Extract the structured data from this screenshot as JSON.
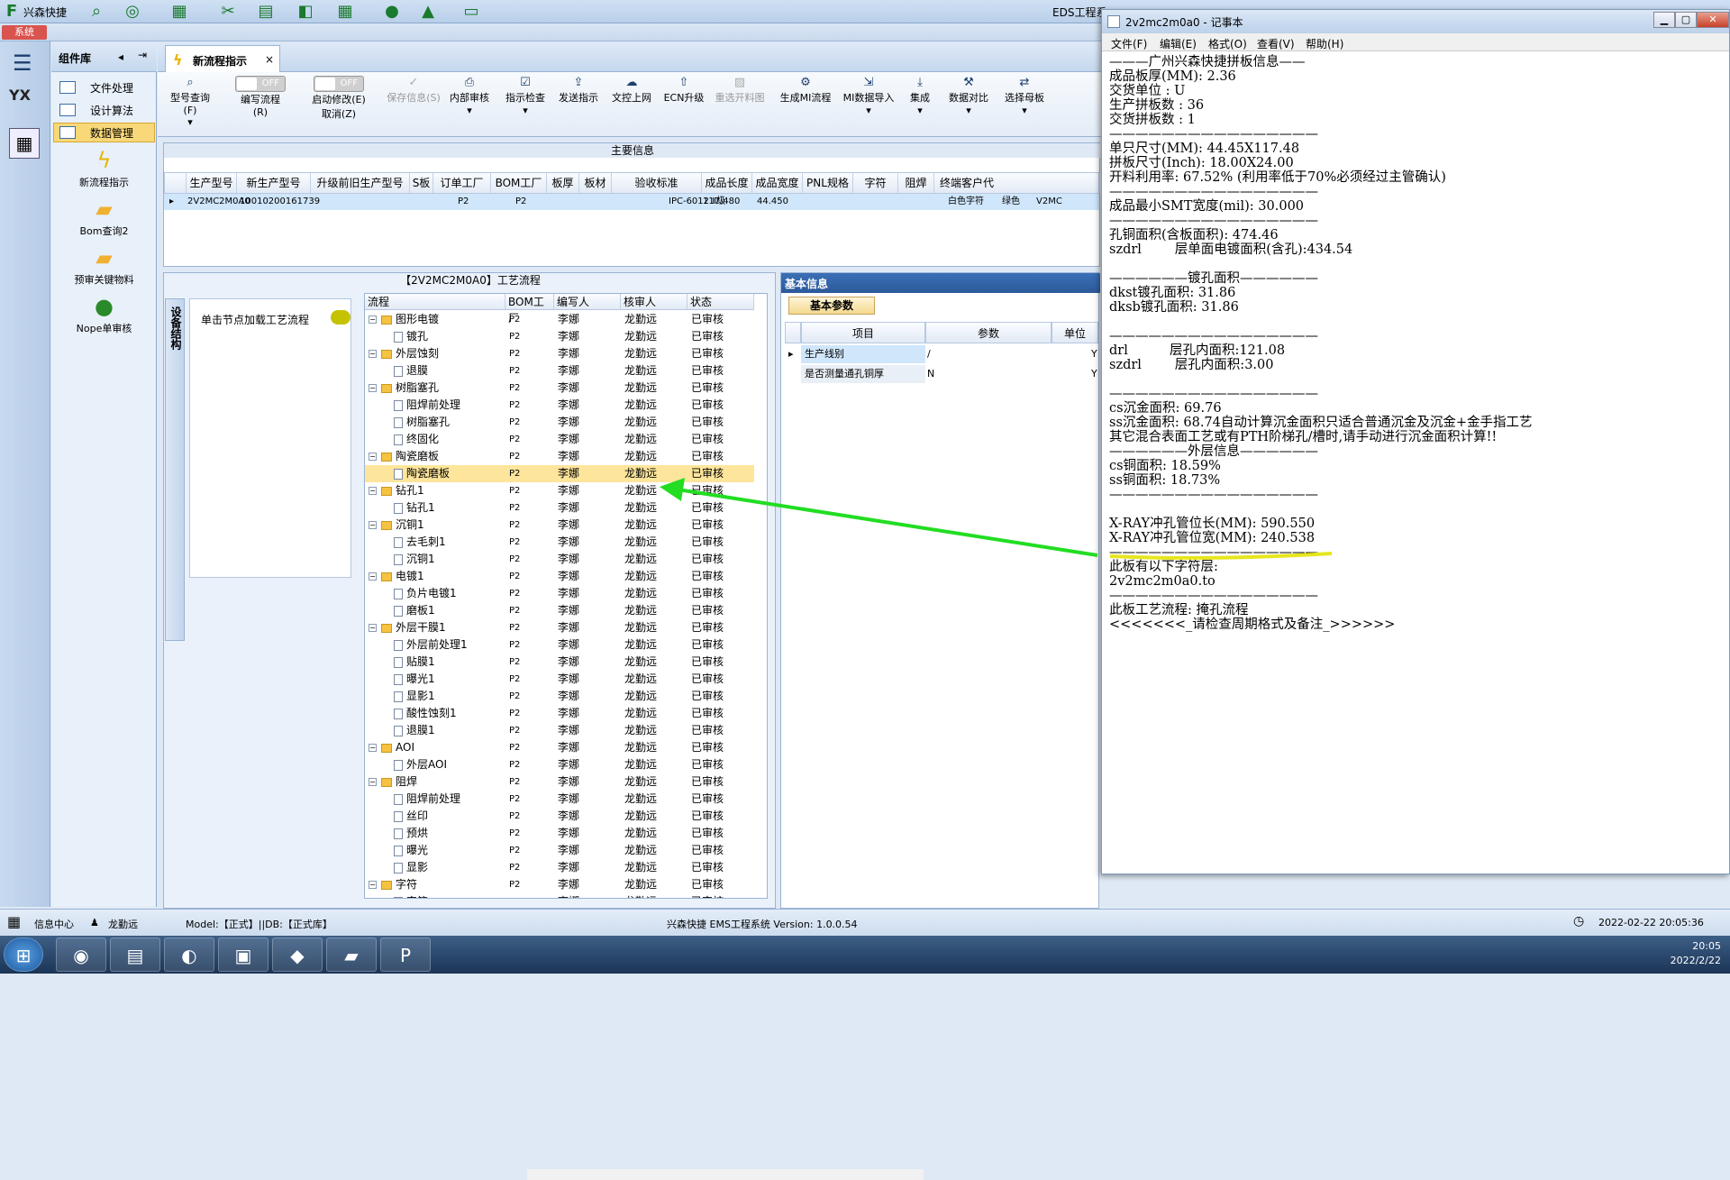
{
  "app": {
    "title": "兴森快捷",
    "eds_title": "EDS工程系",
    "system_tab": "系统"
  },
  "leftbar": {
    "logo": "YX"
  },
  "complib": {
    "header": "组件库",
    "nav": [
      {
        "label": "文件处理"
      },
      {
        "label": "设计算法"
      },
      {
        "label": "数据管理"
      }
    ],
    "launchers": [
      {
        "label": "新流程指示",
        "icon": "lightning-icon"
      },
      {
        "label": "Bom查询2",
        "icon": "folder-icon"
      },
      {
        "label": "预审关键物料",
        "icon": "folder-icon"
      },
      {
        "label": "Nope单审核",
        "icon": "user-icon"
      }
    ]
  },
  "doctab": {
    "label": "新流程指示",
    "close": "×"
  },
  "ribbon": {
    "items": [
      {
        "label": "型号查询(F)",
        "sub": "▾",
        "icon": "search-icon"
      },
      {
        "label": "编写流程(R)",
        "toggle": "OFF"
      },
      {
        "label": "启动修改(E)",
        "label2": "取消(Z)",
        "toggle": "OFF"
      },
      {
        "label": "保存信息(S)",
        "icon": "check-icon"
      },
      {
        "label": "内部审核",
        "sub": "▾",
        "icon": "print-icon"
      },
      {
        "label": "指示检查",
        "sub": "▾",
        "icon": "check-icon"
      },
      {
        "label": "发送指示",
        "icon": "send-icon"
      },
      {
        "label": "文控上网",
        "icon": "cloud-icon"
      },
      {
        "label": "ECN升级",
        "icon": "upgrade-icon"
      },
      {
        "label": "重选开料图",
        "icon": "image-icon"
      },
      {
        "label": "生成MI流程",
        "icon": "gear-icon"
      },
      {
        "label": "MI数据导入",
        "sub": "▾",
        "icon": "import-icon"
      },
      {
        "label": "集成",
        "sub": "▾",
        "icon": "download-icon"
      },
      {
        "label": "数据对比",
        "sub": "▾",
        "icon": "tool-icon"
      },
      {
        "label": "选择母板",
        "sub": "▾",
        "icon": "shuffle-icon"
      }
    ]
  },
  "maininfo": {
    "caption": "主要信息",
    "columns": [
      "生产型号",
      "新生产型号",
      "升级前旧生产型号",
      "S板",
      "订单工厂",
      "BOM工厂",
      "板厚",
      "板材",
      "验收标准",
      "成品长度",
      "成品宽度",
      "PNL规格",
      "字符",
      "阻焊",
      "终端客户代"
    ],
    "row": [
      "2V2MC2M0A0",
      "10010200161739",
      "",
      "",
      "P2",
      "P2",
      "",
      "",
      "IPC-6012 Ⅱ级",
      "117.480",
      "44.450",
      "",
      "白色字符",
      "绿色",
      "V2MC"
    ]
  },
  "process": {
    "caption": "【2V2MC2M0A0】工艺流程",
    "vtab": "设备结构",
    "hint": "单击节点加载工艺流程",
    "columns": [
      "流程",
      "BOM工厂",
      "编写人",
      "核审人",
      "状态"
    ],
    "rows": [
      {
        "name": "图形电镀",
        "lvl": 0
      },
      {
        "name": "镀孔",
        "lvl": 1
      },
      {
        "name": "外层蚀刻",
        "lvl": 0
      },
      {
        "name": "退膜",
        "lvl": 1
      },
      {
        "name": "树脂塞孔",
        "lvl": 0
      },
      {
        "name": "阻焊前处理",
        "lvl": 1
      },
      {
        "name": "树脂塞孔",
        "lvl": 1
      },
      {
        "name": "终固化",
        "lvl": 1
      },
      {
        "name": "陶瓷磨板",
        "lvl": 0
      },
      {
        "name": "陶瓷磨板",
        "lvl": 1,
        "sel": true
      },
      {
        "name": "钻孔1",
        "lvl": 0
      },
      {
        "name": "钻孔1",
        "lvl": 1
      },
      {
        "name": "沉铜1",
        "lvl": 0
      },
      {
        "name": "去毛刺1",
        "lvl": 1
      },
      {
        "name": "沉铜1",
        "lvl": 1
      },
      {
        "name": "电镀1",
        "lvl": 0
      },
      {
        "name": "负片电镀1",
        "lvl": 1
      },
      {
        "name": "磨板1",
        "lvl": 1
      },
      {
        "name": "外层干膜1",
        "lvl": 0
      },
      {
        "name": "外层前处理1",
        "lvl": 1
      },
      {
        "name": "贴膜1",
        "lvl": 1
      },
      {
        "name": "曝光1",
        "lvl": 1
      },
      {
        "name": "显影1",
        "lvl": 1
      },
      {
        "name": "酸性蚀刻1",
        "lvl": 1
      },
      {
        "name": "退膜1",
        "lvl": 1
      },
      {
        "name": "AOI",
        "lvl": 0
      },
      {
        "name": "外层AOI",
        "lvl": 1
      },
      {
        "name": "阻焊",
        "lvl": 0
      },
      {
        "name": "阻焊前处理",
        "lvl": 1
      },
      {
        "name": "丝印",
        "lvl": 1
      },
      {
        "name": "预烘",
        "lvl": 1
      },
      {
        "name": "曝光",
        "lvl": 1
      },
      {
        "name": "显影",
        "lvl": 1
      },
      {
        "name": "字符",
        "lvl": 0
      },
      {
        "name": "字符",
        "lvl": 1
      }
    ],
    "factory": "P2",
    "writer": "李娜",
    "reviewer": "龙勤远",
    "status": "已审核"
  },
  "basic": {
    "header": "基本信息",
    "sub": "基本参数",
    "columns": [
      "项目",
      "参数",
      "单位"
    ],
    "rows": [
      {
        "item": "生产线别",
        "param": "/",
        "unit": "Y"
      },
      {
        "item": "是否测量通孔铜厚",
        "param": "N",
        "unit": "Y"
      }
    ]
  },
  "notepad": {
    "title": "2v2mc2m0a0 - 记事本",
    "menu": [
      "文件(F)",
      "编辑(E)",
      "格式(O)",
      "查看(V)",
      "帮助(H)"
    ],
    "text": "———广州兴森快捷拼板信息——\n成品板厚(MM): 2.36\n交货单位 : U\n生产拼板数 : 36\n交货拼板数 : 1\n————————————————\n单只尺寸(MM): 44.45X117.48\n拼板尺寸(Inch): 18.00X24.00\n开料利用率: 67.52% (利用率低于70%必须经过主管确认)\n————————————————\n成品最小SMT宽度(mil): 30.000\n————————————————\n孔铜面积(含板面积): 474.46\nszdrl        层单面电镀面积(含孔):434.54\n\n——————镀孔面积——————\ndkst镀孔面积: 31.86\ndksb镀孔面积: 31.86\n\n————————————————\ndrl          层孔内面积:121.08\nszdrl        层孔内面积:3.00\n\n————————————————\ncs沉金面积: 69.76\nss沉金面积: 68.74自动计算沉金面积只适合普通沉金及沉金+金手指工艺\n其它混合表面工艺或有PTH阶梯孔/槽时,请手动进行沉金面积计算!!\n——————外层信息——————\ncs铜面积: 18.59%\nss铜面积: 18.73%\n————————————————\n\nX-RAY冲孔管位长(MM): 590.550\nX-RAY冲孔管位宽(MM): 240.538\n————————————————\n此板有以下字符层:\n2v2mc2m0a0.to\n————————————————\n此板工艺流程: 掩孔流程\n<<<<<<<_请检查周期格式及备注_>>>>>>"
  },
  "status": {
    "info": "信息中心",
    "user": "龙勤远",
    "model": "Model:【正式】||DB:【正式库】",
    "version": "兴森快捷 EMS工程系统 Version: 1.0.0.54",
    "datetime": "2022-02-22 20:05:36"
  },
  "taskbar": {
    "time": "20:05",
    "date": "2022/2/22"
  },
  "colors": {
    "accent": "#2c5a9a",
    "arrow": "#22dd22",
    "highlight": "#e6e61e"
  }
}
